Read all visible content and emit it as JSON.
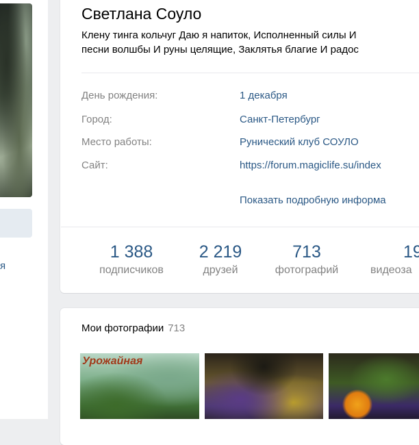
{
  "profile": {
    "name": "Светлана Соуло",
    "status_line1": "Клену тинга кольчуг Даю я напиток, Исполненный силы И",
    "status_line2": "песни волшбы И руны целящие, Заклятья благие И радос"
  },
  "info": [
    {
      "label": "День рождения:",
      "value": "1 декабря"
    },
    {
      "label": "Город:",
      "value": "Санкт-Петербург"
    },
    {
      "label": "Место работы:",
      "value": "Рунический клуб СОУЛО"
    },
    {
      "label": "Сайт:",
      "value": "https://forum.magiclife.su/index"
    }
  ],
  "more_link": "Показать подробную информа",
  "counters": [
    {
      "number": "1 388",
      "label": "подписчиков"
    },
    {
      "number": "2 219",
      "label": "друзей"
    },
    {
      "number": "713",
      "label": "фотографий"
    },
    {
      "number": "19",
      "label": "видеоза"
    }
  ],
  "photos": {
    "title": "Мои фотографии",
    "count": "713",
    "photo1_caption": "Урожайная"
  },
  "left": {
    "text_fragment": "я"
  }
}
